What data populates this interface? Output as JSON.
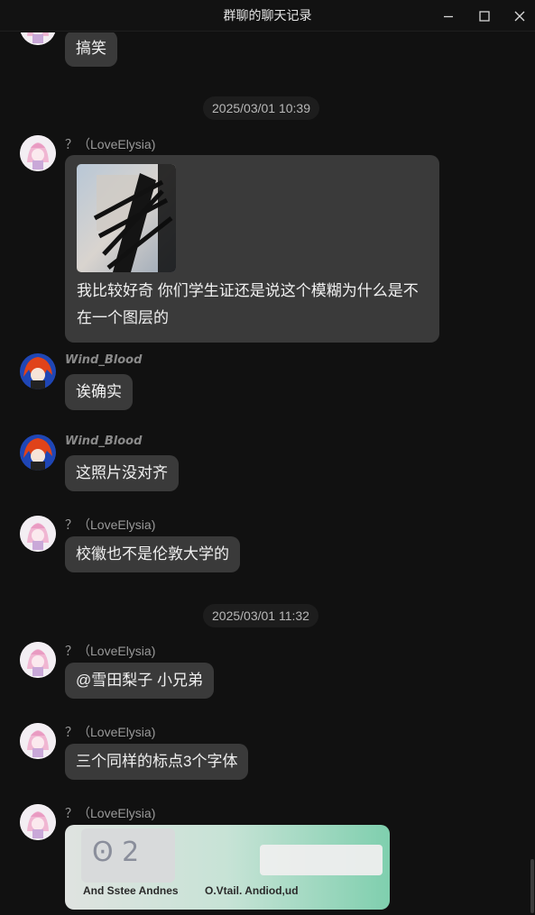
{
  "window": {
    "title": "群聊的聊天记录",
    "minimize_icon": "minimize-icon",
    "maximize_icon": "maximize-icon",
    "close_icon": "close-icon"
  },
  "messages": [
    {
      "sender": "",
      "type": "text",
      "text": "搞笑",
      "avatar": "elysia-avatar"
    },
    {
      "timestamp": "2025/03/01 10:39"
    },
    {
      "sender": "？（LoveElysia)",
      "type": "image_text",
      "text": "我比较好奇 你们学生证还是说这个模糊为什么是不在一个图层的",
      "avatar": "elysia-avatar"
    },
    {
      "sender": "Wind_Blood",
      "type": "text",
      "text": "诶确实",
      "avatar": "wind-avatar"
    },
    {
      "sender": "Wind_Blood",
      "type": "text",
      "text": "这照片没对齐",
      "avatar": "wind-avatar"
    },
    {
      "sender": "？（LoveElysia)",
      "type": "text",
      "text": "校徽也不是伦敦大学的",
      "avatar": "elysia-avatar"
    },
    {
      "timestamp": "2025/03/01 11:32"
    },
    {
      "sender": "？（LoveElysia)",
      "type": "text",
      "text": "@雪田梨子 小兄弟",
      "avatar": "elysia-avatar"
    },
    {
      "sender": "？（LoveElysia)",
      "type": "text",
      "text": "三个同样的标点3个字体",
      "avatar": "elysia-avatar"
    },
    {
      "sender": "？（LoveElysia)",
      "type": "image",
      "image_labels": [
        "And Sstee Andnes",
        "O.Vtail. Andiod,ud"
      ],
      "avatar": "elysia-avatar"
    }
  ],
  "colors": {
    "background": "#111111",
    "bubble": "#3a3a3a",
    "timestamp_bg": "#1d1d1d",
    "sender": "#9a9a9a"
  }
}
